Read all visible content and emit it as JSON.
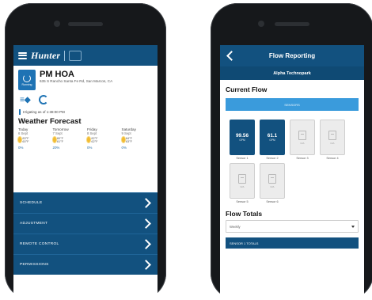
{
  "left_screen": {
    "header": {
      "brand": "Hunter"
    },
    "site": {
      "name": "PM HOA",
      "address": "635 S Rancho Santa Fe Rd, San Marcos, CA",
      "status_icon_label": "Running"
    },
    "status": "Irrigating as of 1:38:00 PM",
    "weather": {
      "title": "Weather Forecast",
      "days": [
        {
          "name": "Today",
          "date": "6 Sept",
          "temps": "83°F 60°F",
          "rain": "0%"
        },
        {
          "name": "Tomorrow",
          "date": "7 Sept",
          "temps": "80°F 61°F",
          "rain": "20%"
        },
        {
          "name": "Friday",
          "date": "8 Sept",
          "temps": "82°F 62°F",
          "rain": "0%"
        },
        {
          "name": "Saturday",
          "date": "9 Sept",
          "temps": "84°F 63°F",
          "rain": "0%"
        }
      ]
    },
    "nav": [
      {
        "label": "SCHEDULE"
      },
      {
        "label": "ADJUSTMENT"
      },
      {
        "label": "REMOTE CONTROL"
      },
      {
        "label": "PERMISSIONS"
      }
    ]
  },
  "right_screen": {
    "header": {
      "title": "Flow Reporting"
    },
    "site_name": "Alpha Technopark",
    "current_flow": {
      "title": "Current Flow",
      "tab": "SENSORS",
      "sensors": [
        {
          "value": "99.56",
          "unit": "GPM",
          "name": "Sensor 1",
          "state": "active"
        },
        {
          "value": "61.1",
          "unit": "GPM",
          "name": "Sensor 2",
          "state": "active"
        },
        {
          "value": "",
          "unit": "",
          "name": "Sensor 3",
          "state": "idle",
          "idle_label": "N/A"
        },
        {
          "value": "",
          "unit": "",
          "name": "Sensor 4",
          "state": "idle",
          "idle_label": "N/A"
        },
        {
          "value": "",
          "unit": "",
          "name": "Sensor 5",
          "state": "idle",
          "idle_label": "N/A"
        },
        {
          "value": "",
          "unit": "",
          "name": "Sensor 6",
          "state": "idle",
          "idle_label": "N/A"
        }
      ]
    },
    "flow_totals": {
      "title": "Flow Totals",
      "period": "Weekly",
      "bottom_label": "SENSOR 1 TOTALS"
    }
  },
  "colors": {
    "brand_navy": "#12517f",
    "accent_blue": "#1e73b4",
    "tab_blue": "#3a9bdc",
    "sun": "#f2bc34"
  }
}
